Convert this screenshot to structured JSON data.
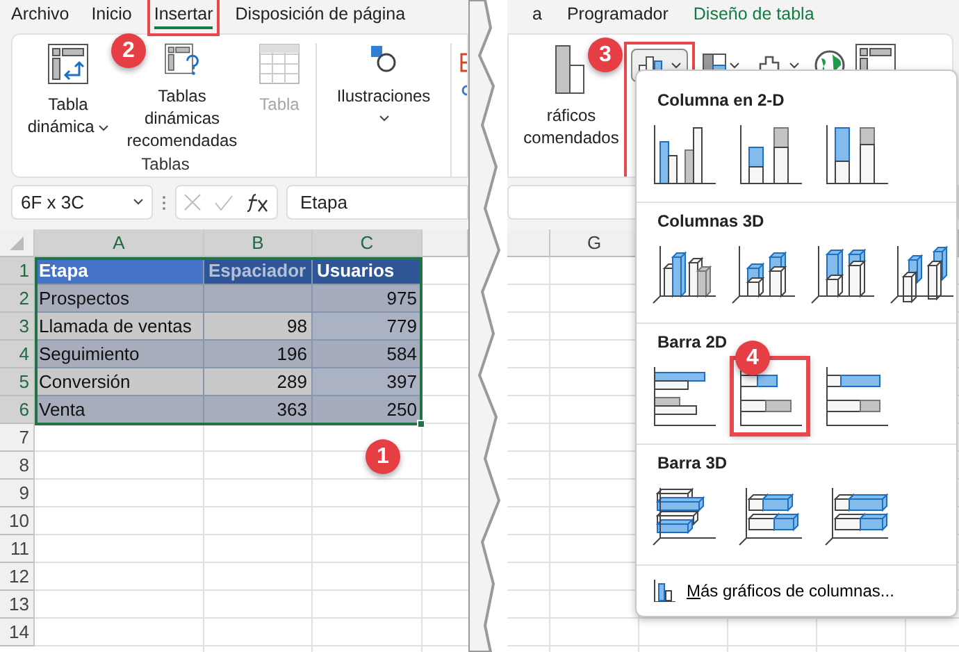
{
  "tabs_left": [
    {
      "label": "Archivo",
      "selected": false
    },
    {
      "label": "Inicio",
      "selected": false
    },
    {
      "label": "Insertar",
      "selected": true
    },
    {
      "label": "Disposición de página",
      "selected": false
    }
  ],
  "tabs_right": [
    {
      "label": "a",
      "kind": "normal"
    },
    {
      "label": "Programador",
      "kind": "normal"
    },
    {
      "label": "Diseño de tabla",
      "kind": "contextual"
    }
  ],
  "ribbon_left": {
    "buttons": [
      {
        "kind": "pivot",
        "label": "Tabla dinámica",
        "dropdown": true,
        "disabled": false
      },
      {
        "kind": "recommended-pivot",
        "label": "Tablas dinámicas recomendadas",
        "dropdown": false,
        "disabled": false
      },
      {
        "kind": "table",
        "label": "Tabla",
        "dropdown": false,
        "disabled": true
      }
    ],
    "group_label": "Tablas",
    "illustrations": {
      "label": "Ilustraciones",
      "dropdown": true
    }
  },
  "ribbon_right": {
    "recommended_charts": [
      "ráficos",
      "comendados"
    ]
  },
  "formula_bar": {
    "name_box": "6F x 3C",
    "formula": "Etapa"
  },
  "sheet": {
    "columns": [
      "A",
      "B",
      "C"
    ],
    "header": [
      {
        "text": "Etapa",
        "dim": false
      },
      {
        "text": "Espaciador",
        "dim": true
      },
      {
        "text": "Usuarios",
        "dim": false
      }
    ],
    "rows": [
      [
        "Prospectos",
        null,
        "975"
      ],
      [
        "Llamada de ventas",
        "98",
        "779"
      ],
      [
        "Seguimiento",
        "196",
        "584"
      ],
      [
        "Conversión",
        "289",
        "397"
      ],
      [
        "Venta",
        "363",
        "250"
      ]
    ],
    "row_numbers": [
      "1",
      "2",
      "3",
      "4",
      "5",
      "6",
      "7",
      "8",
      "9",
      "10",
      "11",
      "12",
      "13",
      "14"
    ],
    "right_columns": [
      "G"
    ]
  },
  "chart_menu": {
    "sections": [
      {
        "title": "Columna en 2-D",
        "options": [
          {
            "kind": "col-clustered",
            "selected": false
          },
          {
            "kind": "col-stacked",
            "selected": false
          },
          {
            "kind": "col-100",
            "selected": false
          }
        ]
      },
      {
        "title": "Columnas 3D",
        "options": [
          {
            "kind": "col3d-clustered",
            "selected": false
          },
          {
            "kind": "col3d-stacked",
            "selected": false
          },
          {
            "kind": "col3d-100",
            "selected": false
          },
          {
            "kind": "col3d",
            "selected": false
          }
        ]
      },
      {
        "title": "Barra 2D",
        "options": [
          {
            "kind": "bar-clustered",
            "selected": false
          },
          {
            "kind": "bar-stacked",
            "selected": true
          },
          {
            "kind": "bar-100",
            "selected": false
          }
        ]
      },
      {
        "title": "Barra 3D",
        "options": [
          {
            "kind": "bar3d-clustered",
            "selected": false
          },
          {
            "kind": "bar3d-stacked",
            "selected": false
          },
          {
            "kind": "bar3d-100",
            "selected": false
          }
        ]
      }
    ],
    "footer": "Más gráficos de columnas..."
  },
  "callouts": [
    "1",
    "2",
    "3",
    "4"
  ]
}
